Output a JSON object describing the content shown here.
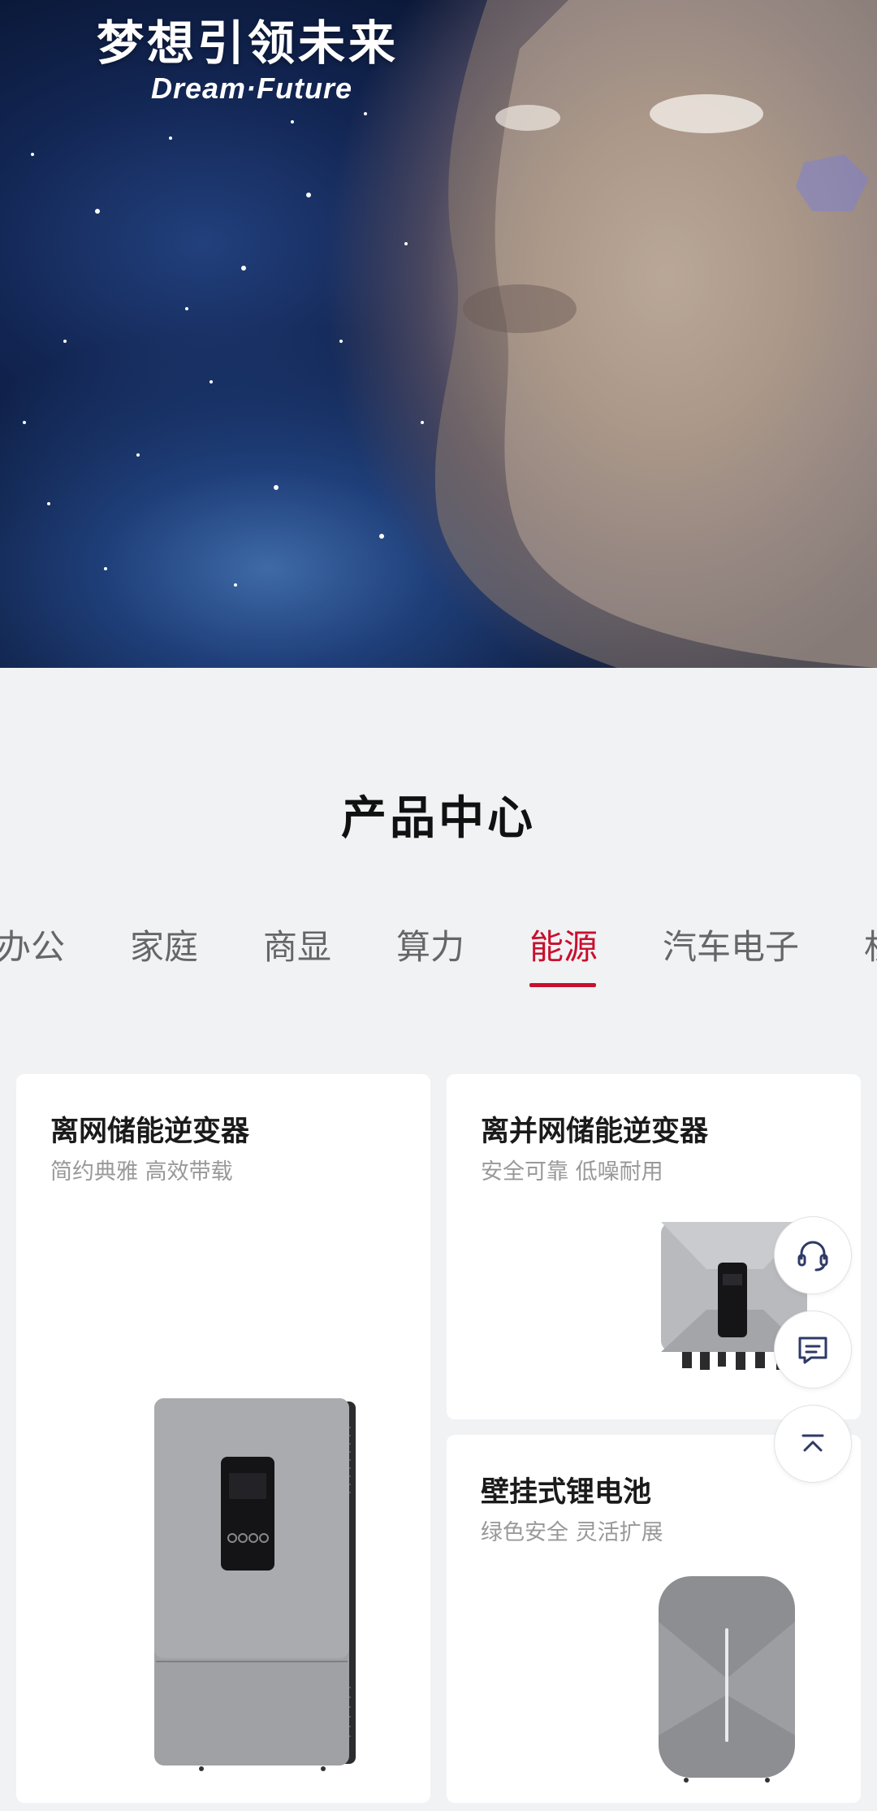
{
  "hero": {
    "title": "梦想引领未来",
    "subtitle": "Dream·Future"
  },
  "section": {
    "title": "产品中心"
  },
  "tabs": [
    {
      "label": "办公"
    },
    {
      "label": "家庭"
    },
    {
      "label": "商显"
    },
    {
      "label": "算力"
    },
    {
      "label": "能源"
    },
    {
      "label": "汽车电子"
    },
    {
      "label": "机"
    }
  ],
  "active_tab": "能源",
  "products": [
    {
      "title": "离网储能逆变器",
      "subtitle": "简约典雅 高效带载"
    },
    {
      "title": "离并网储能逆变器",
      "subtitle": "安全可靠 低噪耐用"
    },
    {
      "title": "壁挂式锂电池",
      "subtitle": "绿色安全 灵活扩展"
    }
  ],
  "floating": {
    "icons": [
      "headset-icon",
      "message-icon",
      "chevron-up-icon"
    ]
  },
  "colors": {
    "accent": "#c8102e",
    "background": "#f1f2f4",
    "card": "#ffffff"
  }
}
